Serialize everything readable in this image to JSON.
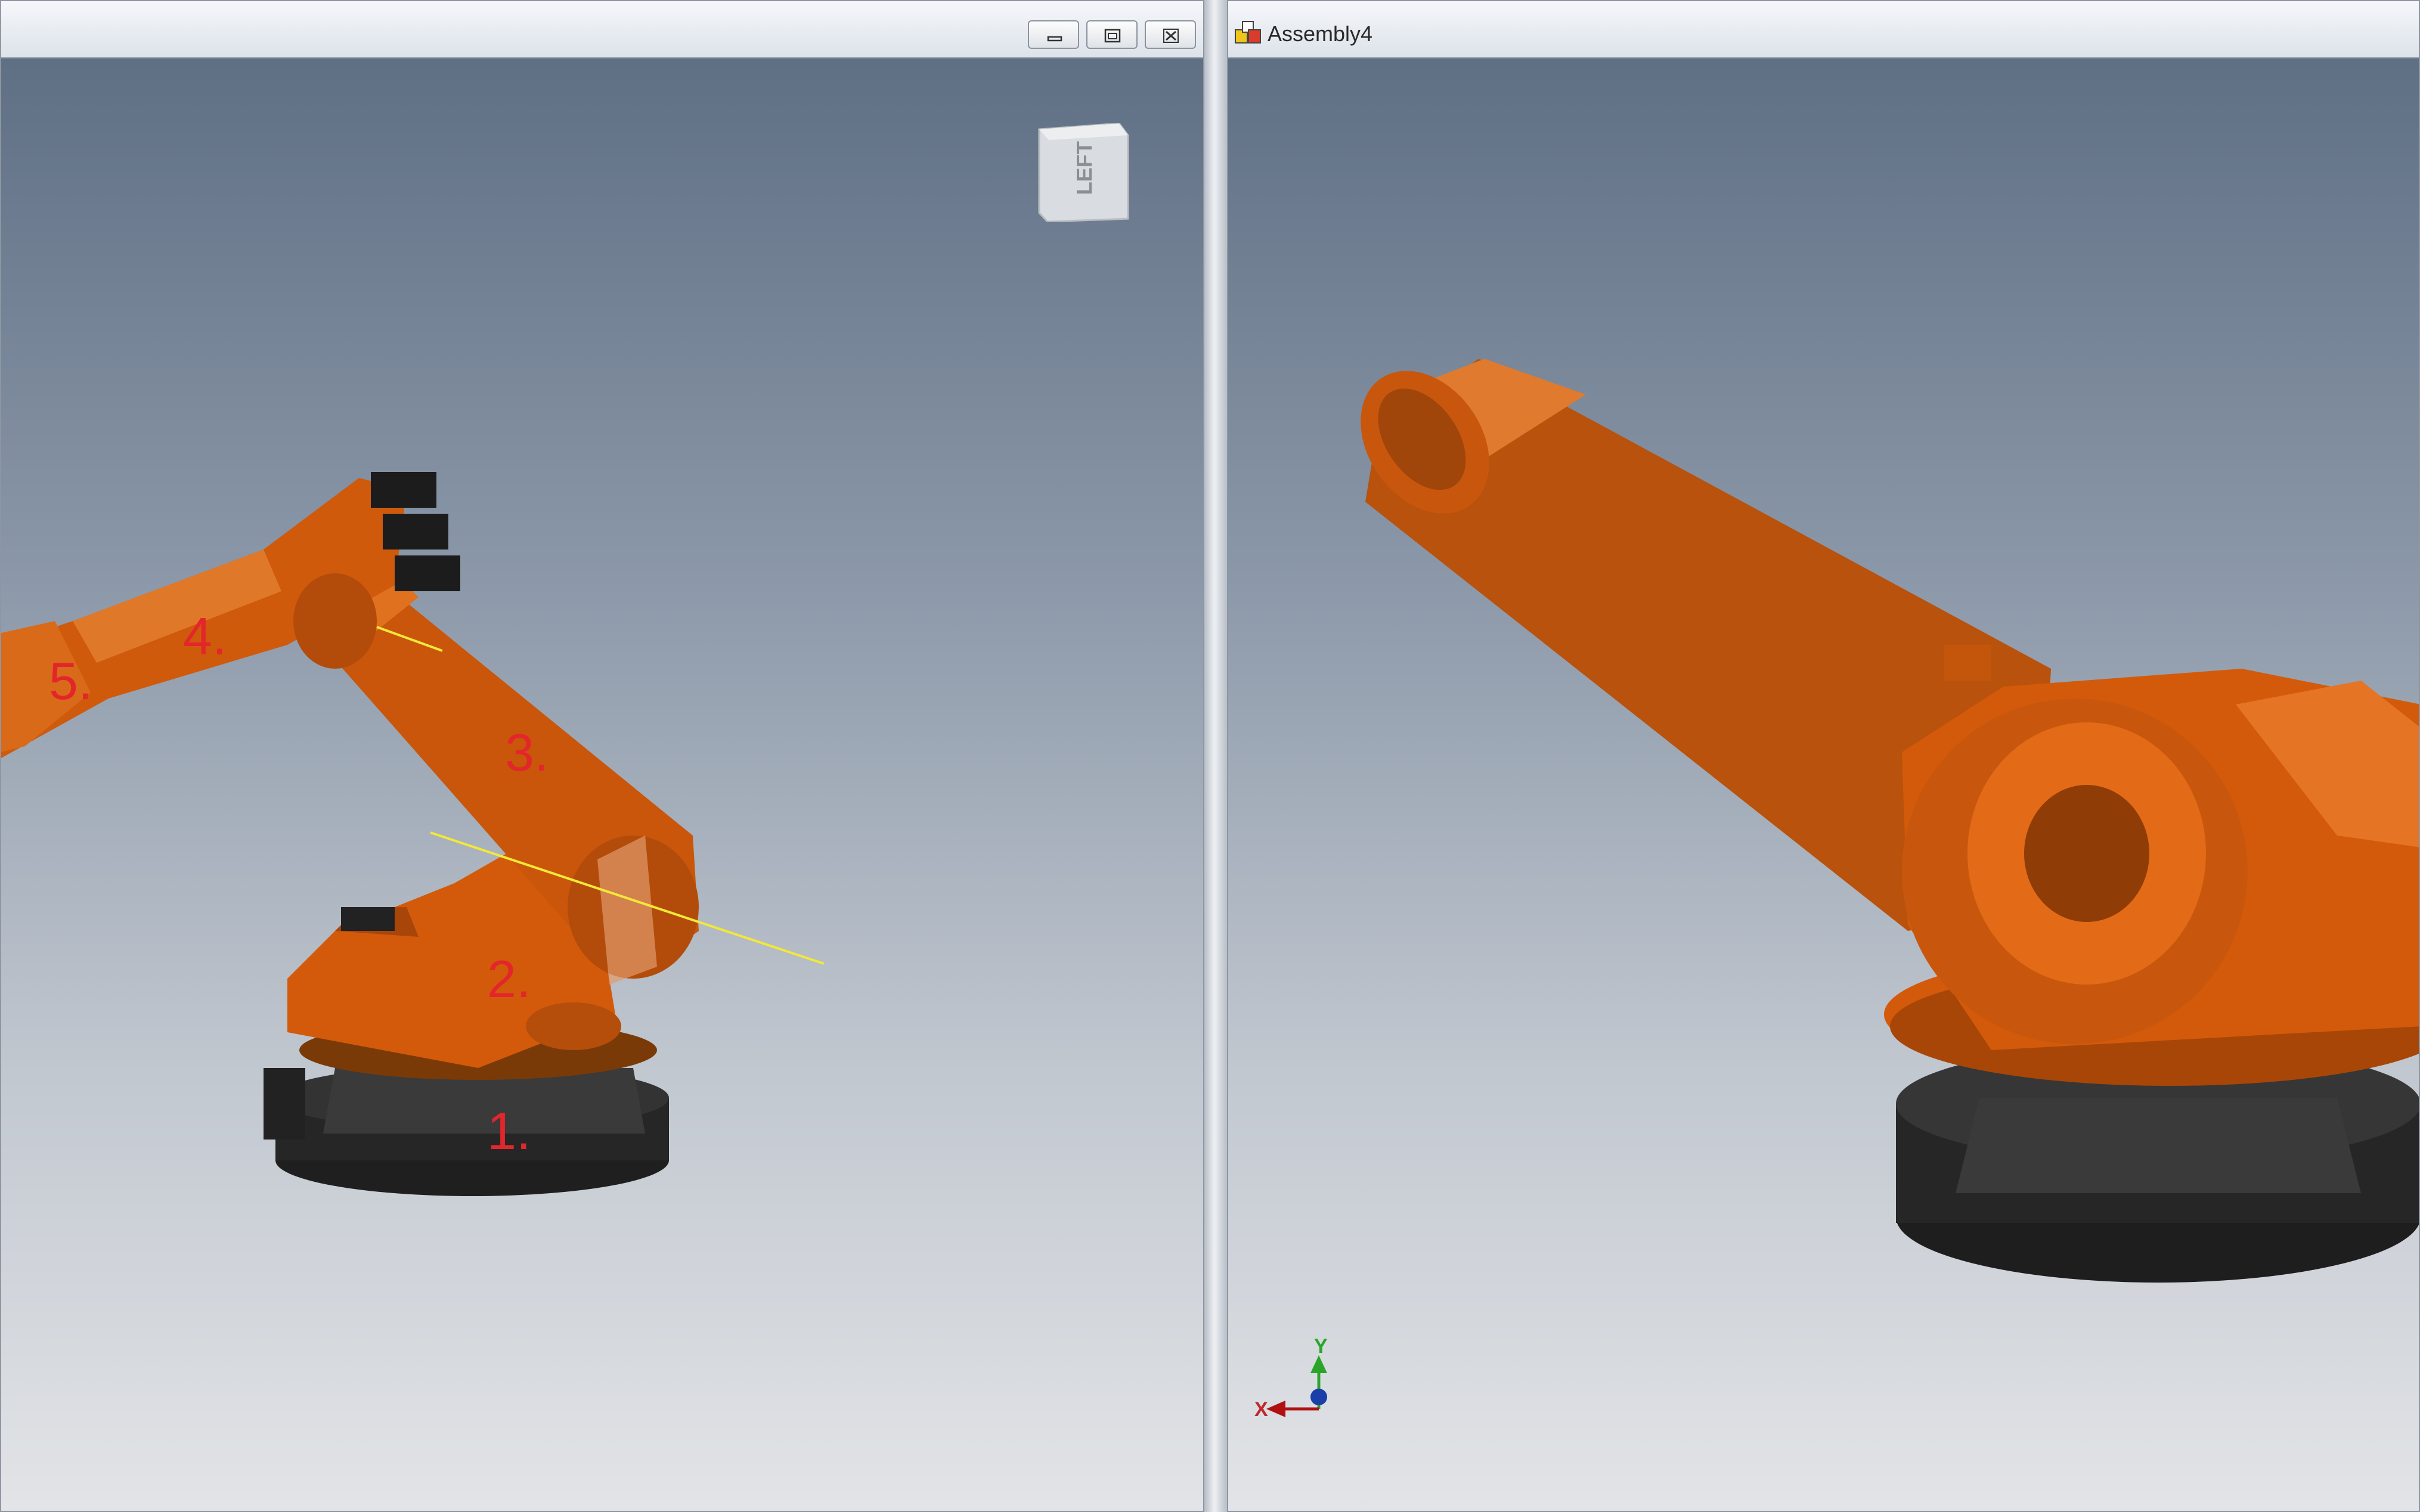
{
  "left_view": {
    "view_cube_label": "LEFT",
    "callouts": [
      "1.",
      "2.",
      "3.",
      "4.",
      "5."
    ]
  },
  "right_view": {
    "document_title": "Assembly4",
    "triad": {
      "y_label": "Y",
      "x_label": "X"
    }
  },
  "colors": {
    "robot_orange": "#d35a0a",
    "robot_dark": "#2b2b2b",
    "callout_red": "#e3262b",
    "axis_line": "#f2e83a"
  }
}
